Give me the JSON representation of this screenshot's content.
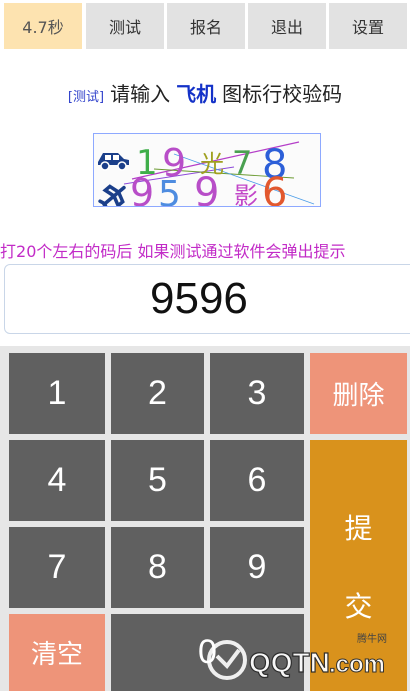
{
  "tabs": [
    {
      "label": "4.7秒",
      "active": true
    },
    {
      "label": "测试",
      "active": false
    },
    {
      "label": "报名",
      "active": false
    },
    {
      "label": "退出",
      "active": false
    },
    {
      "label": "设置",
      "active": false
    }
  ],
  "prompt": {
    "tag": "[测试]",
    "prefix": "请输入",
    "target": "飞机",
    "suffix": "图标行校验码"
  },
  "captcha": {
    "row1": {
      "icon": "car-icon",
      "chars": [
        "1",
        "9",
        "光",
        "7",
        "8"
      ]
    },
    "row2": {
      "icon": "airplane-icon",
      "chars": [
        "9",
        "5",
        "9",
        "影",
        "6"
      ]
    }
  },
  "hint": {
    "before": "打",
    "count": "20",
    "after": "个左右的码后 如果测试通过软件会弹出提示"
  },
  "answer": {
    "value": "9596"
  },
  "keypad": {
    "keys": [
      "1",
      "2",
      "3",
      "4",
      "5",
      "6",
      "7",
      "8",
      "9",
      "0"
    ],
    "delete_label": "删除",
    "submit_label_1": "提",
    "submit_label_2": "交",
    "clear_label": "清空"
  },
  "watermark": {
    "brand": "QQTN",
    "domain": ".com",
    "site": "腾牛网"
  },
  "colors": {
    "active_tab": "#fde3b0",
    "tab": "#e2e2e2",
    "key": "#606060",
    "delete_key": "#ee9479",
    "submit_key": "#d9921c",
    "hint": "#c22bc7",
    "target": "#1432c8"
  }
}
